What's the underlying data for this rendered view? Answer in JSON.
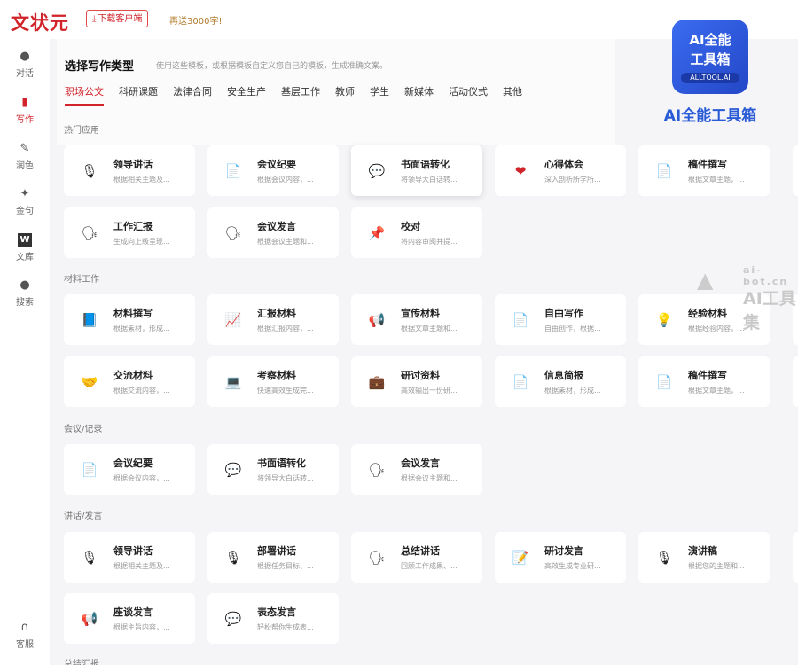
{
  "app": {
    "logo": "文状元",
    "download_label": "下载客户端",
    "gift_label": "再送3000字!"
  },
  "sidebar": [
    {
      "label": "对话",
      "icon": "chat-icon"
    },
    {
      "label": "写作",
      "icon": "write-icon"
    },
    {
      "label": "润色",
      "icon": "polish-icon"
    },
    {
      "label": "金句",
      "icon": "sparkle-icon"
    },
    {
      "label": "文库",
      "icon": "library-icon"
    },
    {
      "label": "搜索",
      "icon": "search-icon"
    },
    {
      "label": "客服",
      "icon": "headset-icon"
    }
  ],
  "header": {
    "title": "选择写作类型",
    "subtitle": "使用这些模板，或根据模板自定义您自己的模板，生成准确文案。",
    "tabs": [
      "职场公文",
      "科研课题",
      "法律合同",
      "安全生产",
      "基层工作",
      "教师",
      "学生",
      "新媒体",
      "活动仪式",
      "其他"
    ],
    "active_tab": "职场公文"
  },
  "sections": {
    "hot": {
      "title": "热门应用",
      "cards": [
        {
          "name": "领导讲话",
          "desc": "根据相关主题及...",
          "icon": "microphone-icon"
        },
        {
          "name": "会议纪要",
          "desc": "根据会议内容，...",
          "icon": "document-icon"
        },
        {
          "name": "书面语转化",
          "desc": "将领导大白话转...",
          "icon": "speech-bubble-icon"
        },
        {
          "name": "心得体会",
          "desc": "深入剖析所学所...",
          "icon": "heart-icon"
        },
        {
          "name": "稿件撰写",
          "desc": "根据文章主题，...",
          "icon": "document-icon"
        },
        {
          "name": "工作汇报",
          "desc": "生成向上级呈现...",
          "icon": "speaking-head-icon"
        },
        {
          "name": "会议发言",
          "desc": "根据会议主题和...",
          "icon": "speaking-head-icon"
        },
        {
          "name": "校对",
          "desc": "将内容审阅并提...",
          "icon": "pushpin-icon"
        }
      ]
    },
    "material": {
      "title": "材料工作",
      "cards": [
        {
          "name": "材料撰写",
          "desc": "根据素材，形成...",
          "icon": "book-icon"
        },
        {
          "name": "汇报材料",
          "desc": "根据汇报内容，...",
          "icon": "chart-icon"
        },
        {
          "name": "宣传材料",
          "desc": "根据文章主题和...",
          "icon": "megaphone-icon"
        },
        {
          "name": "自由写作",
          "desc": "自由创作，根据...",
          "icon": "document-icon"
        },
        {
          "name": "经验材料",
          "desc": "根据经验内容，...",
          "icon": "lightbulb-icon"
        },
        {
          "name": "交流材料",
          "desc": "根据交流内容，...",
          "icon": "handshake-icon"
        },
        {
          "name": "考察材料",
          "desc": "快速高效生成完...",
          "icon": "laptop-person-icon"
        },
        {
          "name": "研讨资料",
          "desc": "高效输出一份研...",
          "icon": "briefcase-icon"
        },
        {
          "name": "信息简报",
          "desc": "根据素材，形成...",
          "icon": "document-icon"
        },
        {
          "name": "稿件撰写",
          "desc": "根据文章主题，...",
          "icon": "document-icon"
        }
      ]
    },
    "meeting": {
      "title": "会议/记录",
      "cards": [
        {
          "name": "会议纪要",
          "desc": "根据会议内容，...",
          "icon": "document-icon"
        },
        {
          "name": "书面语转化",
          "desc": "将领导大白话转...",
          "icon": "speech-bubble-icon"
        },
        {
          "name": "会议发言",
          "desc": "根据会议主题和...",
          "icon": "speaking-head-icon"
        }
      ]
    },
    "speech": {
      "title": "讲话/发言",
      "cards": [
        {
          "name": "领导讲话",
          "desc": "根据相关主题及...",
          "icon": "microphone-icon"
        },
        {
          "name": "部署讲话",
          "desc": "根据任务目标、...",
          "icon": "microphone-icon"
        },
        {
          "name": "总结讲话",
          "desc": "回顾工作成果、...",
          "icon": "speaking-head-icon"
        },
        {
          "name": "研讨发言",
          "desc": "高效生成专业研...",
          "icon": "memo-icon"
        },
        {
          "name": "演讲稿",
          "desc": "根据您的主题和...",
          "icon": "microphone-icon"
        },
        {
          "name": "座谈发言",
          "desc": "根据主旨内容，...",
          "icon": "megaphone-icon"
        },
        {
          "name": "表态发言",
          "desc": "轻松帮你生成表...",
          "icon": "speech-bubble-icon"
        }
      ]
    },
    "summary": {
      "title": "总结汇报"
    }
  },
  "ad": {
    "line1": "AI全能",
    "line2": "工具箱",
    "line3": "ALLTOOL.AI",
    "caption": "AI全能工具箱"
  },
  "watermark": {
    "line1": "ai-bot.cn",
    "line2": "AI工具集"
  }
}
